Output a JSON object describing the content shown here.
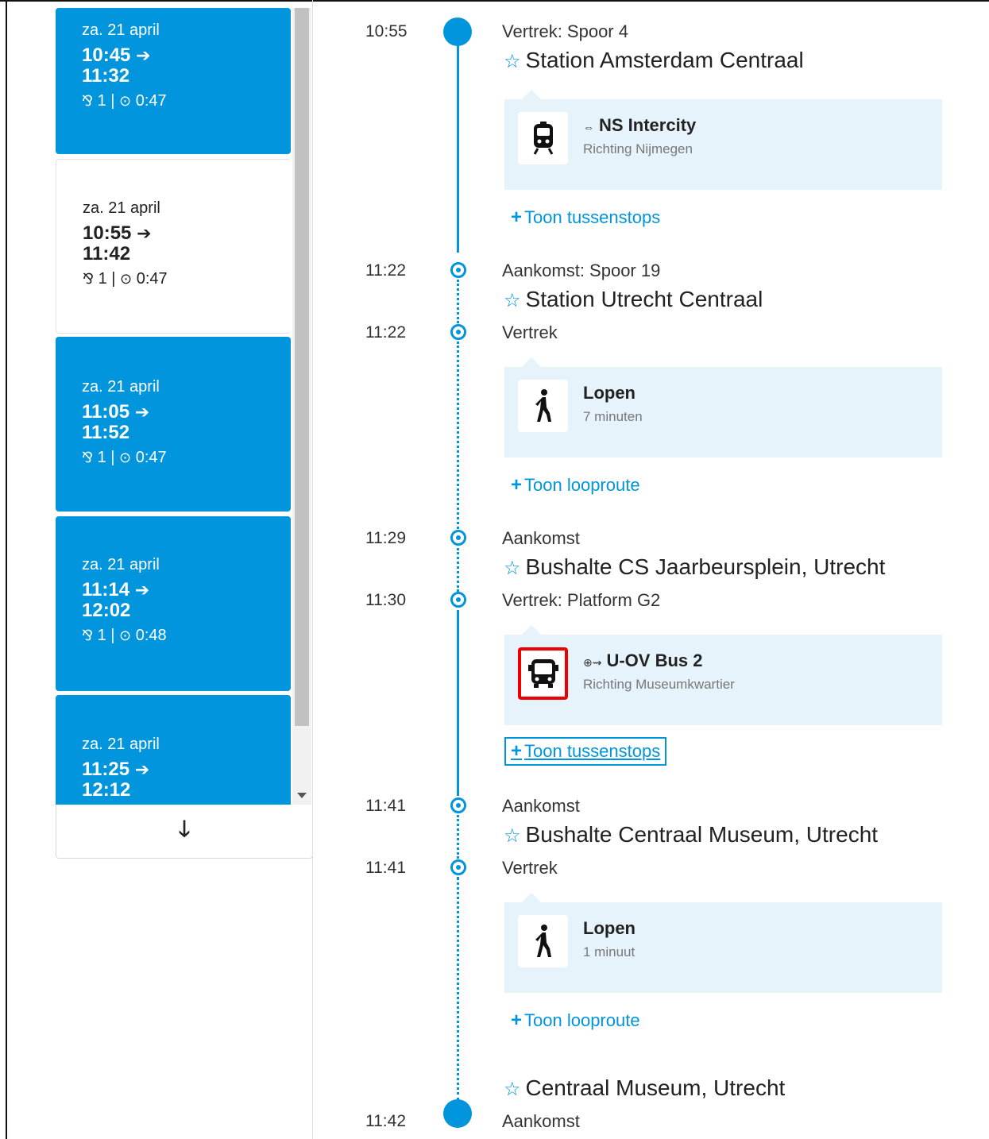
{
  "trip_options": [
    {
      "date": "za. 21 april",
      "depart": "10:45",
      "arrive": "11:32",
      "transfers": "1",
      "duration": "0:47",
      "selected": false
    },
    {
      "date": "za. 21 april",
      "depart": "10:55",
      "arrive": "11:42",
      "transfers": "1",
      "duration": "0:47",
      "selected": true
    },
    {
      "date": "za. 21 april",
      "depart": "11:05",
      "arrive": "11:52",
      "transfers": "1",
      "duration": "0:47",
      "selected": false
    },
    {
      "date": "za. 21 april",
      "depart": "11:14",
      "arrive": "12:02",
      "transfers": "1",
      "duration": "0:48",
      "selected": false
    },
    {
      "date": "za. 21 april",
      "depart": "11:25",
      "arrive": "12:12",
      "transfers": "",
      "duration": "",
      "selected": false
    }
  ],
  "icons": {
    "arrow": "right-arrow",
    "transfer": "transfer-icon",
    "clock": "clock-icon",
    "more": "down-arrow-icon",
    "star": "star-icon",
    "train": "train-icon",
    "walk": "walk-icon",
    "bus": "bus-icon"
  },
  "colors": {
    "accent": "#0095dc",
    "leg_bg": "#e6f3fb",
    "highlight": "#e00000"
  },
  "details": {
    "stop1": {
      "time": "10:55",
      "label": "Vertrek: Spoor 4",
      "station": "Station Amsterdam Centraal"
    },
    "leg1": {
      "mode_marker": "⇔",
      "title": "NS Intercity",
      "subtitle": "Richting Nijmegen",
      "link": "Toon tussenstops"
    },
    "stop2": {
      "arr_time": "11:22",
      "arr_label": "Aankomst: Spoor 19",
      "station": "Station Utrecht Centraal",
      "dep_time": "11:22",
      "dep_label": "Vertrek"
    },
    "leg2": {
      "title": "Lopen",
      "subtitle": "7 minuten",
      "link": "Toon looproute"
    },
    "stop3": {
      "arr_time": "11:29",
      "arr_label": "Aankomst",
      "station": "Bushalte CS Jaarbeursplein, Utrecht",
      "dep_time": "11:30",
      "dep_label": "Vertrek: Platform G2"
    },
    "leg3": {
      "mode_marker": "⊕⇝",
      "title": "U-OV Bus 2",
      "subtitle": "Richting Museumkwartier",
      "link": "Toon tussenstops"
    },
    "stop4": {
      "arr_time": "11:41",
      "arr_label": "Aankomst",
      "station": "Bushalte Centraal Museum, Utrecht",
      "dep_time": "11:41",
      "dep_label": "Vertrek"
    },
    "leg4": {
      "title": "Lopen",
      "subtitle": "1 minuut",
      "link": "Toon looproute"
    },
    "stop5": {
      "station": "Centraal Museum, Utrecht",
      "time": "11:42",
      "label": "Aankomst"
    }
  }
}
